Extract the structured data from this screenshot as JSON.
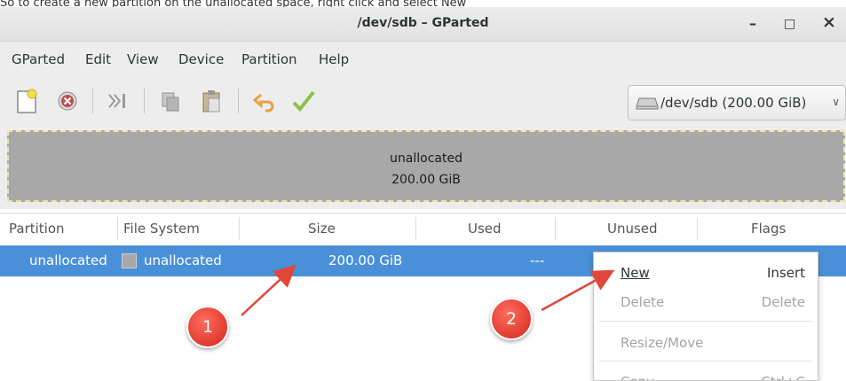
{
  "top_caption": "So to create a new partition on the unallocated space, right click and select New",
  "window": {
    "title": "/dev/sdb – GParted",
    "minimize": "–",
    "maximize": "□",
    "close": "×"
  },
  "menubar": [
    "GParted",
    "Edit",
    "View",
    "Device",
    "Partition",
    "Help"
  ],
  "device_selector": {
    "label": "/dev/sdb  (200.00 GiB)"
  },
  "graph": {
    "name": "unallocated",
    "size": "200.00 GiB"
  },
  "columns": [
    "Partition",
    "File System",
    "Size",
    "Used",
    "Unused",
    "Flags"
  ],
  "row": {
    "partition": "unallocated",
    "file_system": "unallocated",
    "size": "200.00 GiB",
    "used": "---"
  },
  "context_menu": {
    "items": [
      {
        "label": "New",
        "accel": "Insert"
      },
      {
        "label": "Delete",
        "accel": "Delete"
      },
      {
        "label": "Resize/Move",
        "accel": ""
      },
      {
        "label": "Copy",
        "accel": "Ctrl+C"
      }
    ]
  },
  "callouts": [
    "1",
    "2"
  ],
  "colors": {
    "selection": "#4a90d9",
    "badge": "#e2392c",
    "arrow": "#e0463a"
  }
}
